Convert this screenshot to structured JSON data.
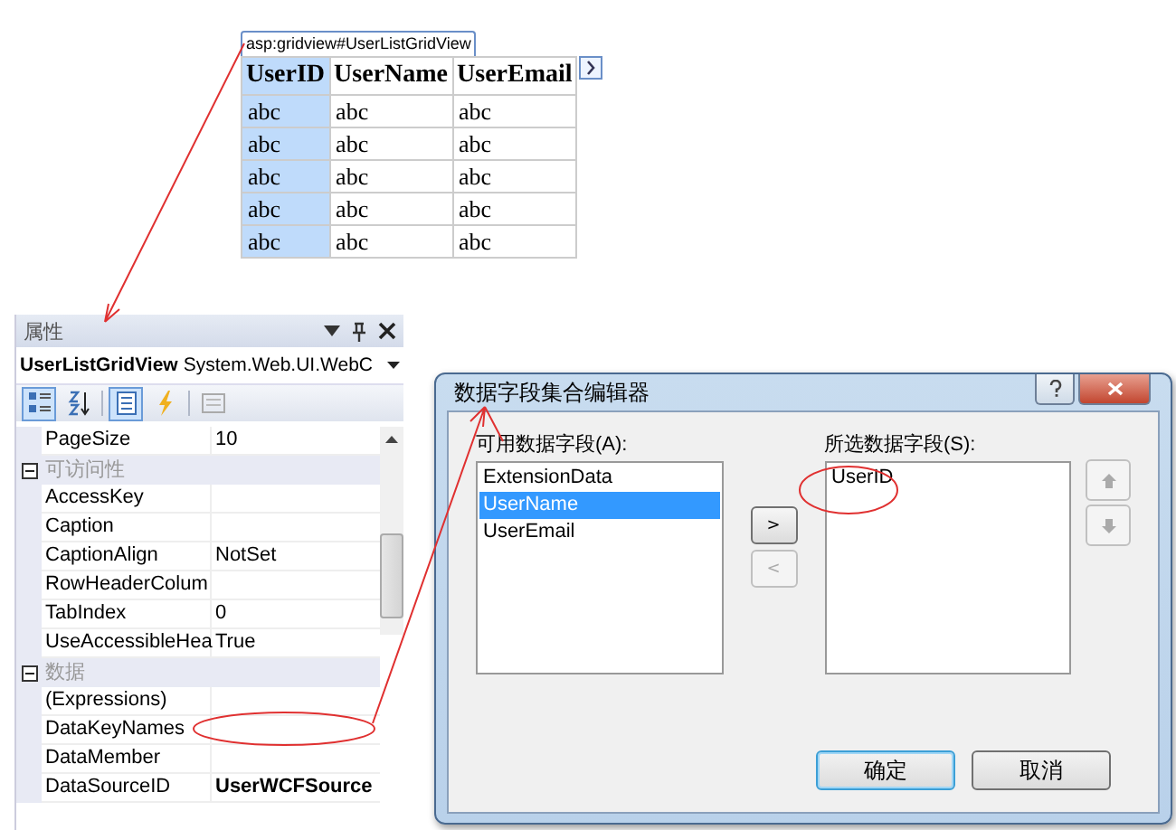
{
  "designer": {
    "tag": "asp:gridview#UserListGridView",
    "columns": [
      {
        "header": "UserID",
        "selected": true
      },
      {
        "header": "UserName",
        "selected": false
      },
      {
        "header": "UserEmail",
        "selected": false
      }
    ],
    "rows": [
      [
        "abc",
        "abc",
        "abc"
      ],
      [
        "abc",
        "abc",
        "abc"
      ],
      [
        "abc",
        "abc",
        "abc"
      ],
      [
        "abc",
        "abc",
        "abc"
      ],
      [
        "abc",
        "abc",
        "abc"
      ]
    ]
  },
  "properties": {
    "title": "属性",
    "object_name": "UserListGridView",
    "object_type": "System.Web.UI.WebC",
    "toolbar": [
      {
        "kind": "categorized",
        "selected": true
      },
      {
        "kind": "alphabetical",
        "selected": false
      },
      {
        "kind": "properties",
        "selected": true
      },
      {
        "kind": "events",
        "selected": false
      },
      {
        "kind": "pages",
        "selected": false
      }
    ],
    "rows": [
      {
        "kind": "property",
        "name": "PageSize",
        "value": "10",
        "modified": false
      },
      {
        "kind": "category",
        "name": "可访问性",
        "expanded": true
      },
      {
        "kind": "property",
        "name": "AccessKey",
        "value": ""
      },
      {
        "kind": "property",
        "name": "Caption",
        "value": ""
      },
      {
        "kind": "property",
        "name": "CaptionAlign",
        "value": "NotSet",
        "modified": false
      },
      {
        "kind": "property",
        "name": "RowHeaderColum",
        "value": ""
      },
      {
        "kind": "property",
        "name": "TabIndex",
        "value": "0",
        "modified": false
      },
      {
        "kind": "property",
        "name": "UseAccessibleHea",
        "value": "True",
        "modified": false
      },
      {
        "kind": "category",
        "name": "数据",
        "expanded": true
      },
      {
        "kind": "property",
        "name": "(Expressions)",
        "value": ""
      },
      {
        "kind": "property",
        "name": "DataKeyNames",
        "value": ""
      },
      {
        "kind": "property",
        "name": "DataMember",
        "value": ""
      },
      {
        "kind": "property",
        "name": "DataSourceID",
        "value": "UserWCFSource",
        "modified": true
      }
    ]
  },
  "dialog": {
    "title": "数据字段集合编辑器",
    "available_label": "可用数据字段(A):",
    "available": [
      {
        "text": "ExtensionData",
        "selected": false
      },
      {
        "text": "UserName",
        "selected": true
      },
      {
        "text": "UserEmail",
        "selected": false
      }
    ],
    "add_button": {
      "label": ">",
      "disabled": false
    },
    "remove_button": {
      "label": "<",
      "disabled": true
    },
    "selected_label": "所选数据字段(S):",
    "chosen": [
      {
        "text": "UserID",
        "selected": false
      }
    ],
    "buttons": [
      {
        "label": "确定",
        "default": true
      },
      {
        "label": "取消",
        "default": false
      }
    ]
  }
}
